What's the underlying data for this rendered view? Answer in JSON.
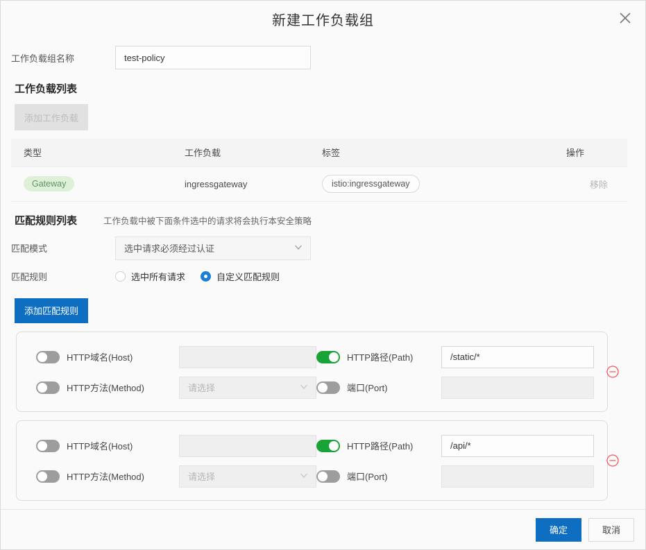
{
  "dialog": {
    "title": "新建工作负载组",
    "close_icon": "close-icon"
  },
  "name_field": {
    "label": "工作负载组名称",
    "value": "test-policy",
    "placeholder": ""
  },
  "workload_section": {
    "title": "工作负载列表",
    "add_button": "添加工作负载",
    "columns": [
      "类型",
      "工作负载",
      "标签",
      "操作"
    ],
    "rows": [
      {
        "type": "Gateway",
        "workload": "ingressgateway",
        "label": "istio:ingressgateway",
        "action": "移除"
      }
    ]
  },
  "match_section": {
    "title": "匹配规则列表",
    "hint": "工作负载中被下面条件选中的请求将会执行本安全策略",
    "mode_label": "匹配模式",
    "mode_value": "选中请求必须经过认证",
    "rule_label": "匹配规则",
    "radios": [
      {
        "label": "选中所有请求",
        "checked": false
      },
      {
        "label": "自定义匹配规则",
        "checked": true
      }
    ],
    "add_rule_button": "添加匹配规则",
    "remove_rule_icon": "minus-circle-icon",
    "rules": [
      {
        "host": {
          "label": "HTTP域名(Host)",
          "on": false,
          "value": "",
          "placeholder": ""
        },
        "path": {
          "label": "HTTP路径(Path)",
          "on": true,
          "value": "/static/*",
          "placeholder": ""
        },
        "method": {
          "label": "HTTP方法(Method)",
          "on": false,
          "value": "",
          "placeholder": "请选择"
        },
        "port": {
          "label": "端口(Port)",
          "on": false,
          "value": "",
          "placeholder": ""
        }
      },
      {
        "host": {
          "label": "HTTP域名(Host)",
          "on": false,
          "value": "",
          "placeholder": ""
        },
        "path": {
          "label": "HTTP路径(Path)",
          "on": true,
          "value": "/api/*",
          "placeholder": ""
        },
        "method": {
          "label": "HTTP方法(Method)",
          "on": false,
          "value": "",
          "placeholder": "请选择"
        },
        "port": {
          "label": "端口(Port)",
          "on": false,
          "value": "",
          "placeholder": ""
        }
      }
    ]
  },
  "footer": {
    "ok": "确定",
    "cancel": "取消"
  },
  "colors": {
    "primary": "#0d6ec2",
    "switch_on": "#19a337",
    "switch_off": "#9d9d9d",
    "tag_bg": "#dff0d8",
    "tag_text": "#5f9464",
    "danger": "#f05b5b",
    "radio_checked": "#1a7fd4"
  }
}
